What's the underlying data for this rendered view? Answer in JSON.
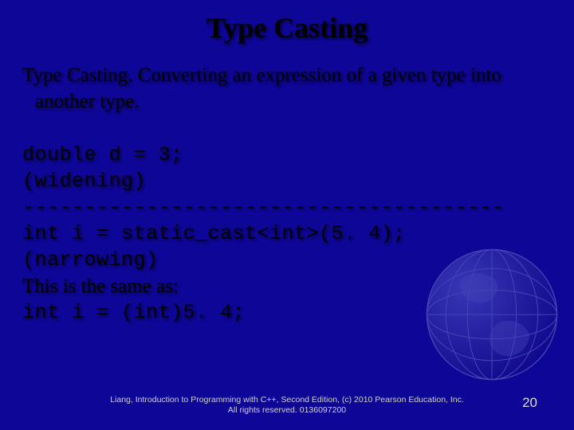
{
  "title": "Type Casting",
  "definition": "Type Casting. Converting an expression of a given type into another type.",
  "code": {
    "l1": "double d = 3;",
    "l2": "(widening)",
    "sep": "---------------------------------------",
    "l3": "int i = static_cast<int>(5. 4);",
    "l4": "(narrowing)",
    "l5": "This is the same as:",
    "l6": "int i = (int)5. 4;"
  },
  "footer": {
    "line1": "Liang, Introduction to Programming with C++, Second Edition, (c) 2010 Pearson Education, Inc.",
    "line2": "All rights reserved. 0136097200"
  },
  "pageNumber": "20"
}
